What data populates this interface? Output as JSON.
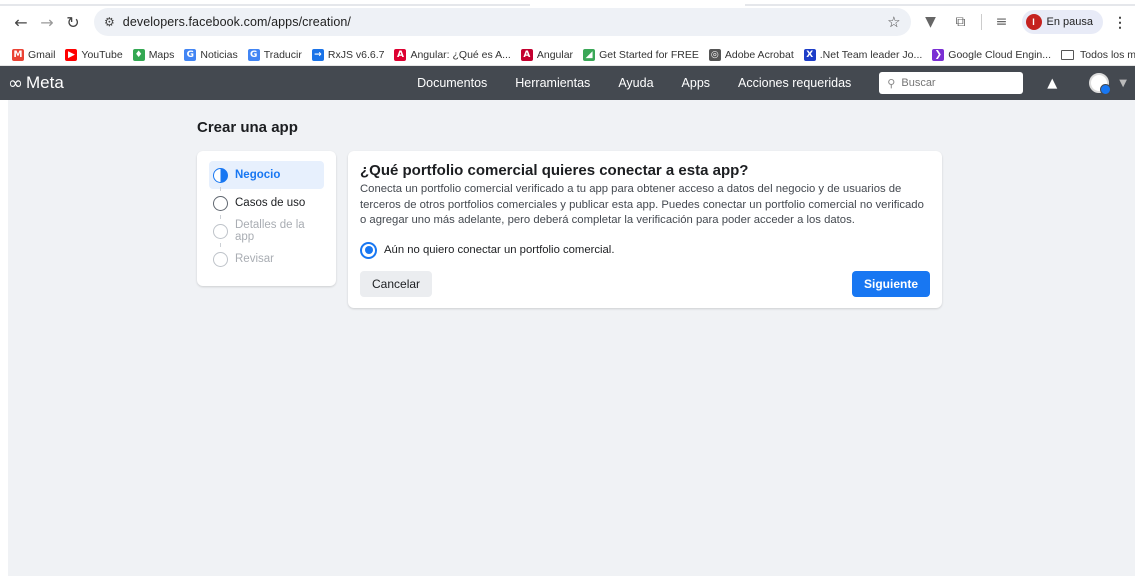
{
  "browser": {
    "url": "developers.facebook.com/apps/creation/",
    "profile_status": "En pausa",
    "profile_initial": "I",
    "bookmarks": [
      {
        "label": "Gmail",
        "icon": "gmail-icon",
        "color": "#ea4335",
        "glyph": "M"
      },
      {
        "label": "YouTube",
        "icon": "youtube-icon",
        "color": "#ff0000",
        "glyph": "▶"
      },
      {
        "label": "Maps",
        "icon": "maps-icon",
        "color": "#34a853",
        "glyph": "♦"
      },
      {
        "label": "Noticias",
        "icon": "news-icon",
        "color": "#4285f4",
        "glyph": "G"
      },
      {
        "label": "Traducir",
        "icon": "translate-icon",
        "color": "#4285f4",
        "glyph": "G"
      },
      {
        "label": "RxJS v6.6.7",
        "icon": "rxjs-icon",
        "color": "#1a73e8",
        "glyph": "→"
      },
      {
        "label": "Angular: ¿Qué es A...",
        "icon": "angular-icon",
        "color": "#dd0031",
        "glyph": "A"
      },
      {
        "label": "Angular",
        "icon": "angular-logo-icon",
        "color": "#c3002f",
        "glyph": "A"
      },
      {
        "label": "Get Started for FREE",
        "icon": "getstarted-icon",
        "color": "#3aa757",
        "glyph": "◢"
      },
      {
        "label": "Adobe Acrobat",
        "icon": "globe-icon",
        "color": "#555555",
        "glyph": "◎"
      },
      {
        "label": ".Net Team leader Jo...",
        "icon": "x-icon",
        "color": "#1d3dc8",
        "glyph": "X"
      },
      {
        "label": "Google Cloud Engin...",
        "icon": "chevron-icon",
        "color": "#7b2fd4",
        "glyph": "❯"
      }
    ],
    "all_bookmarks": "Todos los marcadores"
  },
  "meta_header": {
    "logo_text": "Meta",
    "nav": [
      "Documentos",
      "Herramientas",
      "Ayuda",
      "Apps",
      "Acciones requeridas"
    ],
    "search_placeholder": "Buscar"
  },
  "page": {
    "title": "Crear una app",
    "steps": [
      {
        "label": "Negocio",
        "state": "active"
      },
      {
        "label": "Casos de uso",
        "state": "pending"
      },
      {
        "label": "Detalles de la app",
        "state": "disabled"
      },
      {
        "label": "Revisar",
        "state": "disabled"
      }
    ],
    "question": "¿Qué portfolio comercial quieres conectar a esta app?",
    "description": "Conecta un portfolio comercial verificado a tu app para obtener acceso a datos del negocio y de usuarios de terceros de otros portfolios comerciales y publicar esta app. Puedes conectar un portfolio comercial no verificado o agregar uno más adelante, pero deberá completar la verificación para poder acceder a los datos.",
    "option_label": "Aún no quiero conectar un portfolio comercial.",
    "cancel_label": "Cancelar",
    "next_label": "Siguiente"
  },
  "colors": {
    "accent": "#1877f2",
    "meta_bar": "#444950",
    "page_bg": "#f0f2f5"
  }
}
